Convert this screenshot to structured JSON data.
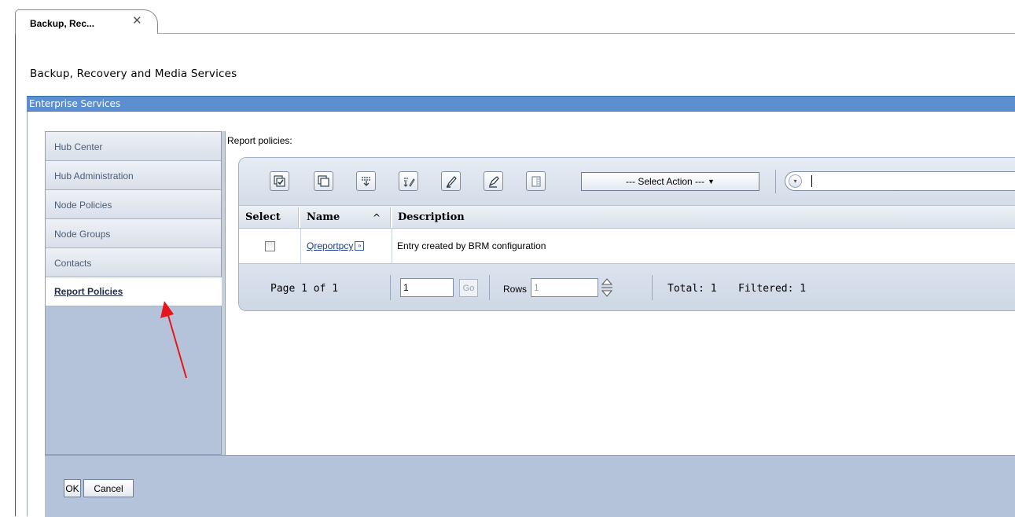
{
  "tab": {
    "label": "Backup, Rec...",
    "close_glyph": "✕"
  },
  "page": {
    "title": "Backup, Recovery and Media Services"
  },
  "section": {
    "title": "Enterprise Services"
  },
  "nav": {
    "items": [
      {
        "label": "Hub Center",
        "selected": false
      },
      {
        "label": "Hub Administration",
        "selected": false
      },
      {
        "label": "Node Policies",
        "selected": false
      },
      {
        "label": "Node Groups",
        "selected": false
      },
      {
        "label": "Contacts",
        "selected": false
      },
      {
        "label": "Report Policies",
        "selected": true
      }
    ]
  },
  "content": {
    "heading": "Report policies:",
    "toolbar": {
      "icons": [
        "select-all-icon",
        "deselect-all-icon",
        "show-filter-icon",
        "edit-filter-icon",
        "edit-sort-icon",
        "clear-sort-icon",
        "collapse-table-icon"
      ],
      "select_action": "--- Select Action ---",
      "filter_glyph": "▾",
      "filter_value": ""
    },
    "table": {
      "columns": [
        "Select",
        "Name",
        "Description"
      ],
      "sort_indicator": "^",
      "rows": [
        {
          "checked": false,
          "name": "Qreportpcy",
          "menu_glyph": "»",
          "description": "Entry created by BRM configuration"
        }
      ]
    },
    "pager": {
      "page_text": "Page 1 of 1",
      "page_value": "1",
      "go_label": "Go",
      "rows_label": "Rows",
      "rows_value": "1",
      "total_text": "Total: 1",
      "filtered_text": "Filtered: 1"
    }
  },
  "footer": {
    "ok_label": "OK",
    "cancel_label": "Cancel"
  },
  "colors": {
    "section_bar": "#5b8fd0",
    "nav_bg": "#b4c3da",
    "link": "#1d3c8c",
    "annotation_arrow": "#e8141c"
  }
}
